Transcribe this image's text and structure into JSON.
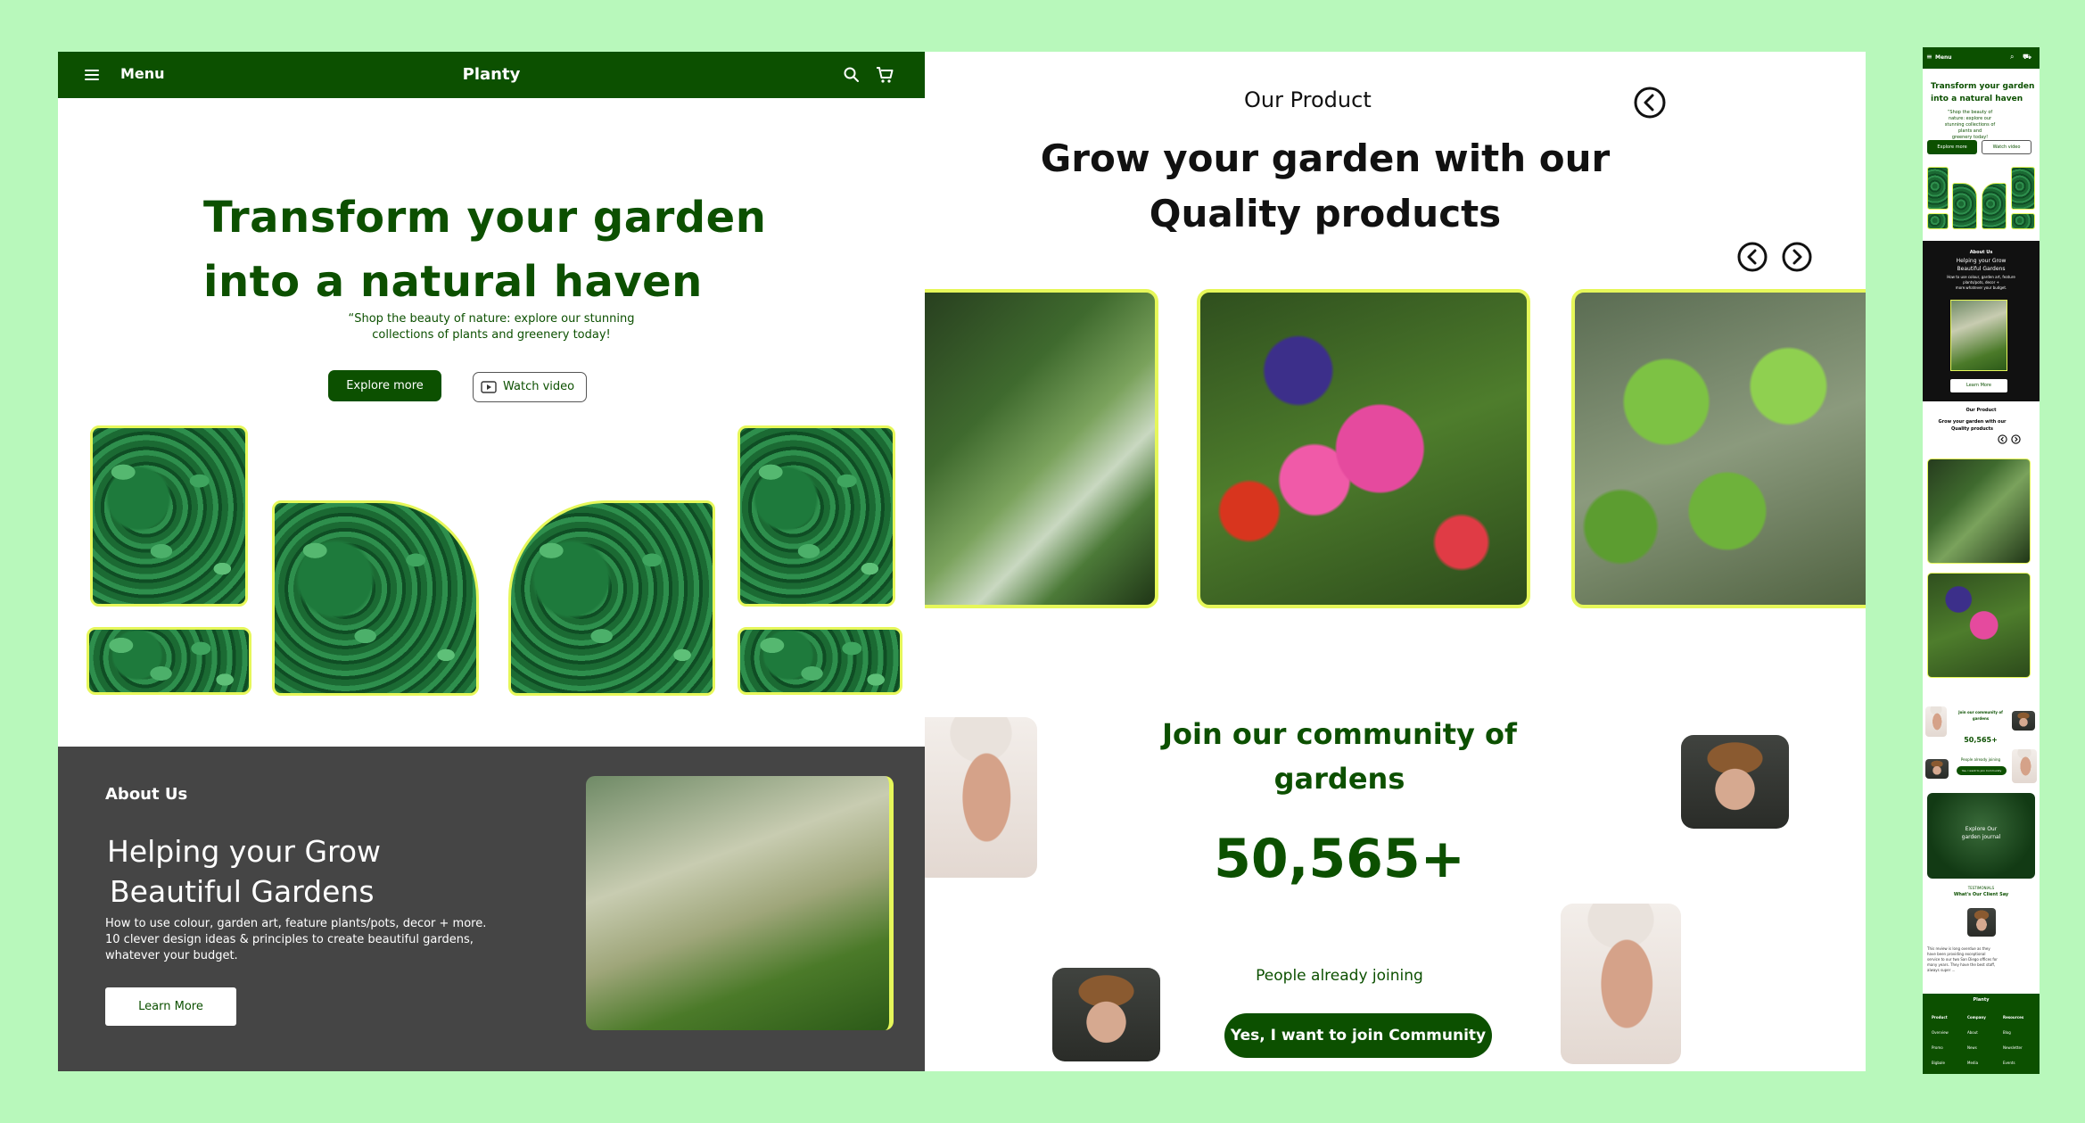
{
  "nav": {
    "menu_label": "Menu",
    "brand": "Planty",
    "icons": [
      "menu-icon",
      "search-icon",
      "cart-icon"
    ]
  },
  "hero": {
    "title_line1": "Transform your garden",
    "title_line2": "into a natural haven",
    "subtitle_line1": "“Shop the beauty of nature: explore our stunning",
    "subtitle_line2": "collections of plants and greenery today!",
    "explore_label": "Explore more",
    "watch_label": "Watch video"
  },
  "about": {
    "label": "About Us",
    "title_line1": "Helping your Grow",
    "title_line2": "Beautiful Gardens",
    "desc_line1": "How to use colour, garden art, feature plants/pots, decor + more.",
    "desc_line2": "10 clever design ideas & principles to create beautiful gardens,",
    "desc_line3": "whatever your budget.",
    "learn_label": "Learn More"
  },
  "product": {
    "pre_title": "Our Product",
    "title_line1": "Grow your garden with our",
    "title_line2": "Quality products"
  },
  "community": {
    "title_line1": "Join our community of",
    "title_line2": "gardens",
    "count": "50,565+",
    "subtitle": "People already joining",
    "cta_label": "Yes, I want to join Community"
  },
  "mini": {
    "menu_label": "Menu",
    "hero_line1": "Transform your garden",
    "hero_line2": "into a natural haven",
    "hero_sub1": "“Shop the beauty of nature: explore our",
    "hero_sub2": "stunning collections of plants and",
    "hero_sub3": "greenery today!",
    "explore_label": "Explore more",
    "watch_label": "Watch video",
    "about_label": "About Us",
    "about_title1": "Helping your Grow",
    "about_title2": "Beautiful Gardens",
    "about_desc1": "How to use colour, garden art, feature",
    "about_desc2": "plants/pots, decor +",
    "about_desc3": "more.whatever your budget.",
    "learn_label": "Learn More",
    "product_pre": "Our Product",
    "product_title1": "Grow your garden with our",
    "product_title2": "Quality products",
    "join_title1": "Join our community of",
    "join_title2": "gardens",
    "join_count": "50,565+",
    "join_sub": "People already joining",
    "join_cta": "Yes, I want to join Community",
    "explore_title1": "Explore Our",
    "explore_title2": "garden journal",
    "testimonials_label": "TESTIMONIALS",
    "testimonials_title": "What's Our Client Say",
    "quote1": "This review is long overdue as they",
    "quote2": "have been providing exceptional",
    "quote3": "service to our two San Diego offices for",
    "quote4": "many years. They have the best staff,",
    "quote5": "always super ...",
    "footer_brand": "Planty",
    "footer_col1": [
      "Product",
      "Overview",
      "Promo",
      "Bigbale"
    ],
    "footer_col2": [
      "Company",
      "About",
      "News",
      "Media"
    ],
    "footer_col3": [
      "Resources",
      "Blog",
      "Newsletter",
      "Events"
    ]
  },
  "colors": {
    "background": "#b8f8bb",
    "brand_green": "#0c5000",
    "accent_yellow": "#e6f75a",
    "about_bg": "#454545"
  }
}
